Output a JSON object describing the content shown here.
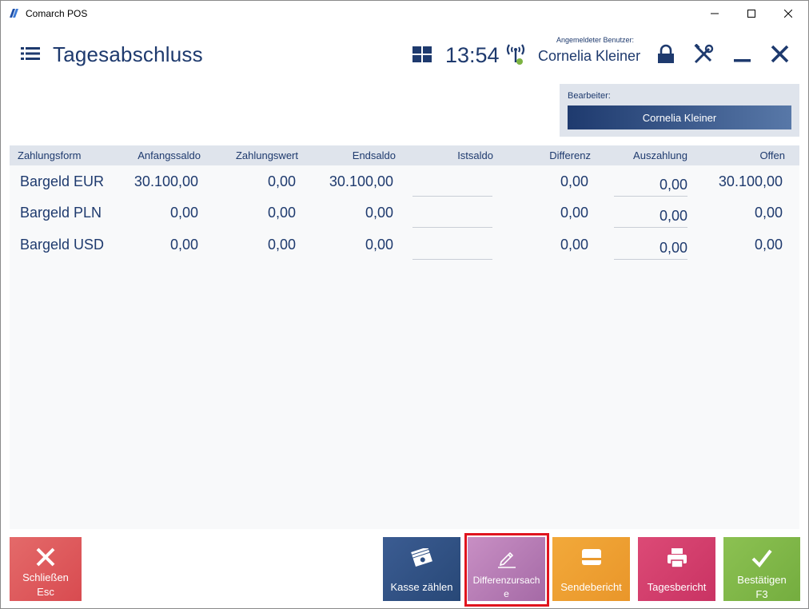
{
  "window": {
    "title": "Comarch POS"
  },
  "header": {
    "page_title": "Tagesabschluss",
    "clock": "13:54",
    "user_caption": "Angemeldeter Benutzer:",
    "user_name": "Cornelia Kleiner"
  },
  "editor": {
    "label": "Bearbeiter:",
    "value": "Cornelia Kleiner"
  },
  "table": {
    "columns": [
      "Zahlungsform",
      "Anfangssaldo",
      "Zahlungswert",
      "Endsaldo",
      "Istsaldo",
      "Differenz",
      "Auszahlung",
      "Offen"
    ],
    "rows": [
      {
        "form": "Bargeld EUR",
        "start": "30.100,00",
        "payment": "0,00",
        "end": "30.100,00",
        "actual": "",
        "difference": "0,00",
        "payout": "0,00",
        "open": "30.100,00"
      },
      {
        "form": "Bargeld PLN",
        "start": "0,00",
        "payment": "0,00",
        "end": "0,00",
        "actual": "",
        "difference": "0,00",
        "payout": "0,00",
        "open": "0,00"
      },
      {
        "form": "Bargeld USD",
        "start": "0,00",
        "payment": "0,00",
        "end": "0,00",
        "actual": "",
        "difference": "0,00",
        "payout": "0,00",
        "open": "0,00"
      }
    ]
  },
  "buttons": {
    "close_line1": "Schließen",
    "close_line2": "Esc",
    "count": "Kasse zählen",
    "diff_line1": "Differenzursach",
    "diff_line2": "e",
    "send": "Sendebericht",
    "daily": "Tagesbericht",
    "confirm_line1": "Bestätigen",
    "confirm_line2": "F3"
  },
  "colors": {
    "primary": "#1e3a6e",
    "close": "#d84b50",
    "count": "#284877",
    "diff": "#a56aa6",
    "send": "#e9962a",
    "daily": "#c93363",
    "confirm": "#74ad3f",
    "highlight": "#e0141e",
    "status_online": "#7cb342"
  }
}
